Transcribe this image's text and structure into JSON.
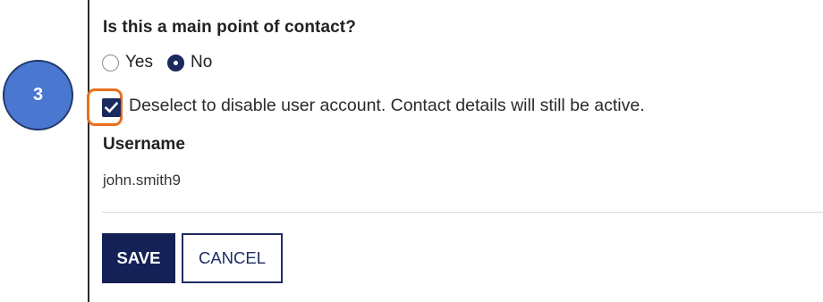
{
  "form": {
    "question": "Is this a main point of contact?",
    "radio_options": [
      {
        "label": "Yes",
        "selected": false
      },
      {
        "label": "No",
        "selected": true
      }
    ],
    "account_checkbox": {
      "checked": true,
      "label": "Deselect to disable user account. Contact details will still be active."
    },
    "username": {
      "title": "Username",
      "value": "john.smith9"
    },
    "buttons": {
      "save_label": "SAVE",
      "cancel_label": "CANCEL"
    }
  },
  "annotation": {
    "step_number": "3",
    "badge_color": "#4a78d0",
    "highlight_color": "#e8701a"
  },
  "colors": {
    "primary": "#142157"
  },
  "icons": {
    "checkbox": "checkmark-icon",
    "radio_selected": "radio-selected-icon",
    "radio_unselected": "radio-unselected-icon"
  }
}
